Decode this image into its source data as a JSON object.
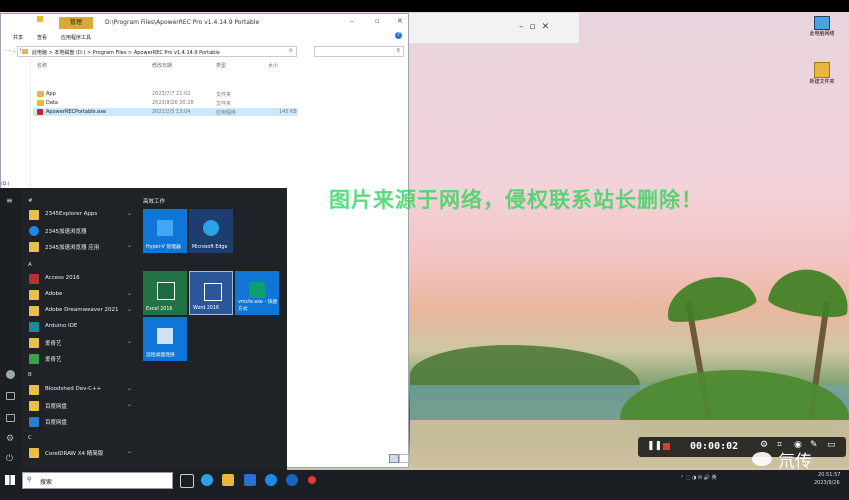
{
  "explorer": {
    "manage_tab": "管理",
    "title_path": "D:\\Program Files\\ApowerREC Pro v1.4.14.9 Portable",
    "ribbon_tabs": [
      "共享",
      "查看",
      "应用程序工具"
    ],
    "breadcrumb": [
      "此电脑",
      "本地磁盘 (D:)",
      "Program Files",
      "ApowerREC Pro v1.4.14.9 Portable"
    ],
    "columns": {
      "name": "名称",
      "date": "修改日期",
      "type": "类型",
      "size": "大小"
    },
    "files": [
      {
        "name": "App",
        "date": "2023/7/7 21:02",
        "type": "文件夹",
        "size": ""
      },
      {
        "name": "Data",
        "date": "2023/9/26 20:28",
        "type": "文件夹",
        "size": ""
      },
      {
        "name": "ApowerRECPortable.exe",
        "date": "2021/2/5 13:04",
        "type": "应用程序",
        "size": "145 KB"
      }
    ],
    "sidebar_drive": "(D:)"
  },
  "start_menu": {
    "tiles_header": "高效工作",
    "sections": [
      "#",
      "A",
      "B",
      "C"
    ],
    "apps": [
      {
        "label": "2345Explorer Apps",
        "chev": "⌄"
      },
      {
        "label": "2345加速浏览器",
        "chev": ""
      },
      {
        "label": "2345加速浏览器 应用",
        "chev": "⌄"
      },
      {
        "label": "Access 2016",
        "chev": ""
      },
      {
        "label": "Adobe",
        "chev": "⌄"
      },
      {
        "label": "Adobe Dreamweaver 2021",
        "chev": "⌄"
      },
      {
        "label": "Arduino IDE",
        "chev": ""
      },
      {
        "label": "爱奇艺",
        "chev": "⌄"
      },
      {
        "label": "爱奇艺",
        "chev": ""
      },
      {
        "label": "Bloodshed Dev-C++",
        "chev": "⌄"
      },
      {
        "label": "百度网盘",
        "chev": "⌄"
      },
      {
        "label": "百度网盘",
        "chev": ""
      },
      {
        "label": "CorelDRAW X4 精简版",
        "chev": "⌄"
      }
    ],
    "tiles": [
      {
        "label": "Hyper-V 管理器"
      },
      {
        "label": "Microsoft Edge"
      },
      {
        "label": "Excel 2016"
      },
      {
        "label": "Word 2016"
      },
      {
        "label": "vmcfe.exe - 快捷方式"
      },
      {
        "label": "远程桌面连接"
      }
    ]
  },
  "taskbar": {
    "search_placeholder": "搜索",
    "time": "20:51:57",
    "date": "2023/9/26"
  },
  "recorder": {
    "time": "00:00:02"
  },
  "watermark": {
    "text": "图片来源于网络，侵权联系站长删除！"
  },
  "wechat_brand": {
    "text": "氘传"
  },
  "desktop_icons": [
    {
      "label": "此电脑网络"
    },
    {
      "label": "新建文件夹"
    }
  ]
}
